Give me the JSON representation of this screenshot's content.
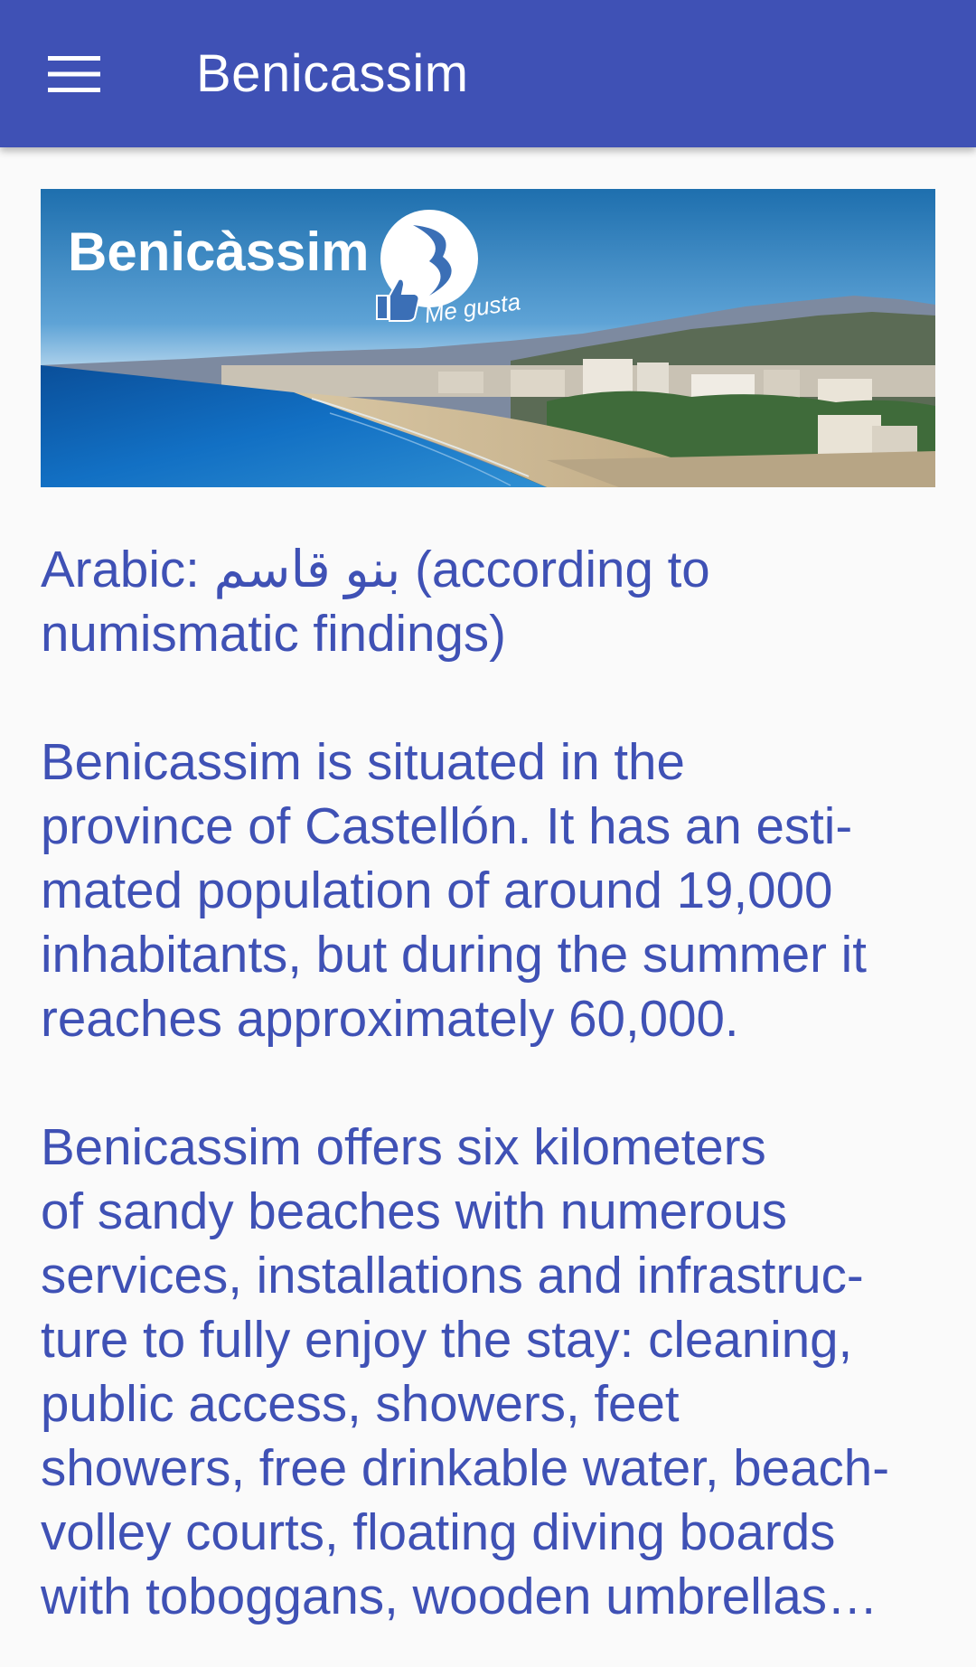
{
  "app_bar": {
    "title": "Benicassim",
    "menu_icon": "menu-icon"
  },
  "banner": {
    "logo_text": "Benicàssim",
    "tagline": "Me gusta",
    "icon": "thumbs-up-icon"
  },
  "article": {
    "paragraph_1": "Arabic: بنو قاسم (according to\nnumismatic findings)",
    "paragraph_2": " Benicassim is situated in the\nprovince of Castellón. It has an esti-\nmated population of around 19,000\ninhabitants, but during the summer it\nreaches approximately 60,000.",
    "paragraph_3": " Benicassim offers six kilometers\nof sandy beaches with numerous\nservices, installations and infrastruc-\nture to fully enjoy the stay: cleaning,\npublic access, showers, feet\nshowers, free drinkable water, beach-\nvolley courts, floating diving boards\nwith toboggans, wooden umbrellas…"
  },
  "colors": {
    "primary": "#3f51b5",
    "background": "#fafafa",
    "on_primary": "#ffffff"
  }
}
